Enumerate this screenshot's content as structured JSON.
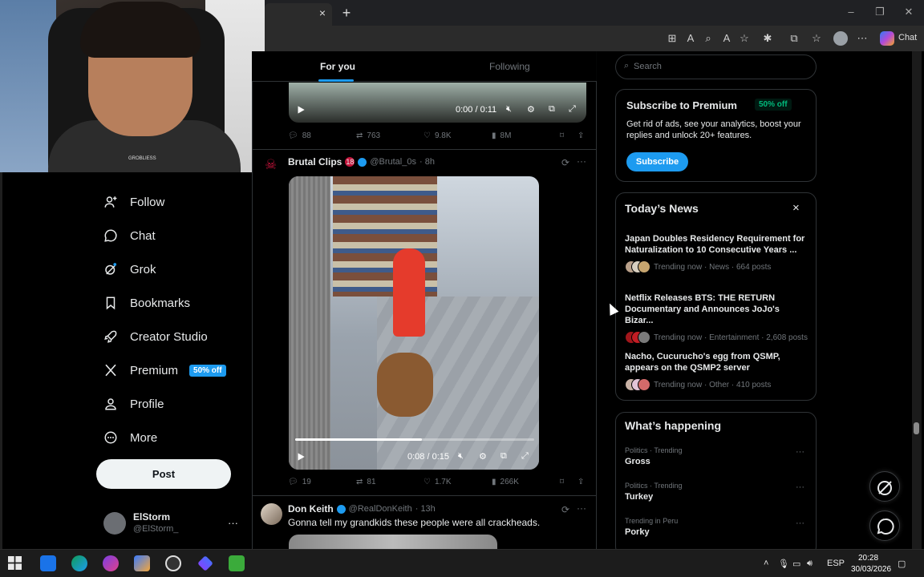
{
  "browser": {
    "tab_close": "×",
    "new_tab": "+",
    "chat_label": "Chat"
  },
  "webcam": {
    "shirt_text": "GROBLIESS"
  },
  "sidebar": {
    "items": [
      {
        "label": "Follow",
        "icon": "follow-icon"
      },
      {
        "label": "Chat",
        "icon": "chat-icon"
      },
      {
        "label": "Grok",
        "icon": "grok-icon"
      },
      {
        "label": "Bookmarks",
        "icon": "bookmark-icon"
      },
      {
        "label": "Creator Studio",
        "icon": "rocket-icon"
      },
      {
        "label": "Premium",
        "icon": "x-logo-icon",
        "badge": "50% off"
      },
      {
        "label": "Profile",
        "icon": "profile-icon"
      },
      {
        "label": "More",
        "icon": "more-circle-icon"
      }
    ],
    "post_label": "Post",
    "account": {
      "name": "ElStorm",
      "handle": "@ElStorm_"
    }
  },
  "feed": {
    "tabs": [
      {
        "label": "For you",
        "active": true
      },
      {
        "label": "Following",
        "active": false
      }
    ],
    "tweet1": {
      "time": "0:00 / 0:11",
      "replies": "88",
      "reposts": "763",
      "likes": "9.8K",
      "views": "8M"
    },
    "tweet2": {
      "name": "Brutal Clips",
      "age_badge": "18",
      "handle": "@Brutal_0s",
      "time_ago": "· 8h",
      "video_time": "0:08 / 0:15",
      "video_progress": 0.53,
      "replies": "19",
      "reposts": "81",
      "likes": "1.7K",
      "views": "266K"
    },
    "tweet3": {
      "name": "Don Keith",
      "handle": "@RealDonKeith",
      "time_ago": "· 13h",
      "text": "Gonna tell my grandkids these people were all crackheads."
    }
  },
  "right": {
    "search_placeholder": "Search",
    "premium": {
      "title": "Subscribe to Premium",
      "badge": "50% off",
      "description": "Get rid of ads, see your analytics, boost your replies and unlock 20+ features.",
      "button": "Subscribe"
    },
    "news": {
      "title": "Today’s News",
      "close": "×",
      "items": [
        {
          "title": "Japan Doubles Residency Requirement for Naturalization to 10 Consecutive Years ...",
          "meta": "Trending now · News · 664 posts"
        },
        {
          "title": "Netflix Releases BTS: THE RETURN Documentary and Announces JoJo's Bizar...",
          "meta": "Trending now · Entertainment · 2,608 posts"
        },
        {
          "title": "Nacho, Cucurucho's egg from QSMP, appears on the QSMP2 server",
          "meta": "Trending now · Other · 410 posts"
        }
      ]
    },
    "happening": {
      "title": "What’s happening",
      "items": [
        {
          "category": "Politics · Trending",
          "name": "Gross"
        },
        {
          "category": "Politics · Trending",
          "name": "Turkey"
        },
        {
          "category": "Trending in Peru",
          "name": "Porky"
        }
      ],
      "more": "···"
    }
  },
  "taskbar": {
    "lang": "ESP",
    "time": "20:28",
    "date": "30/03/2026"
  },
  "colors": {
    "accent": "#1d9bf0",
    "background": "#000000",
    "text": "#e7e9ea",
    "muted": "#71767b",
    "border": "#2f3336"
  }
}
